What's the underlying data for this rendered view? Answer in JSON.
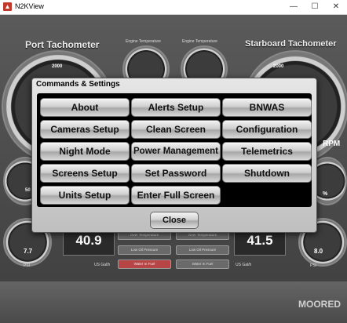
{
  "window": {
    "title": "N2KView",
    "minimize": "—",
    "maximize": "☐",
    "close": "✕"
  },
  "dashboard": {
    "port_title": "Port Tachometer",
    "starboard_title": "Starboard Tachometer",
    "engine_temp_label_1": "Engine Temperature",
    "engine_temp_label_2": "Engine Temperature",
    "port_tick": "2000",
    "starboard_tick": "2000",
    "rpm": "RPM",
    "percent": "%",
    "left_gauge_value": "50",
    "fuel_left_value": "7.7",
    "fuel_right_value": "8.0",
    "port_digital": "40.9",
    "starboard_digital": "41.5",
    "unit_psi_left": "PSI",
    "unit_gal_left": "US Gal/h",
    "unit_gal_right": "US Gal/h",
    "unit_psi_right": "PSI",
    "alarms": [
      {
        "label": "Over Temperature",
        "color": "#6a6a6a"
      },
      {
        "label": "Over Temperature",
        "color": "#6a6a6a"
      },
      {
        "label": "Low Oil Pressure",
        "color": "#6a6a6a"
      },
      {
        "label": "Low Oil Pressure",
        "color": "#6a6a6a"
      },
      {
        "label": "Water In Fuel",
        "color": "#b84545"
      },
      {
        "label": "Water In Fuel",
        "color": "#6a6a6a"
      }
    ],
    "status": "MOORED"
  },
  "dialog": {
    "title": "Commands & Settings",
    "buttons": [
      "About",
      "Alerts Setup",
      "BNWAS",
      "Cameras Setup",
      "Clean Screen",
      "Configuration",
      "Night Mode",
      "Power Management",
      "Telemetrics",
      "Screens Setup",
      "Set Password",
      "Shutdown",
      "Units Setup",
      "Enter Full Screen"
    ],
    "close_label": "Close"
  }
}
